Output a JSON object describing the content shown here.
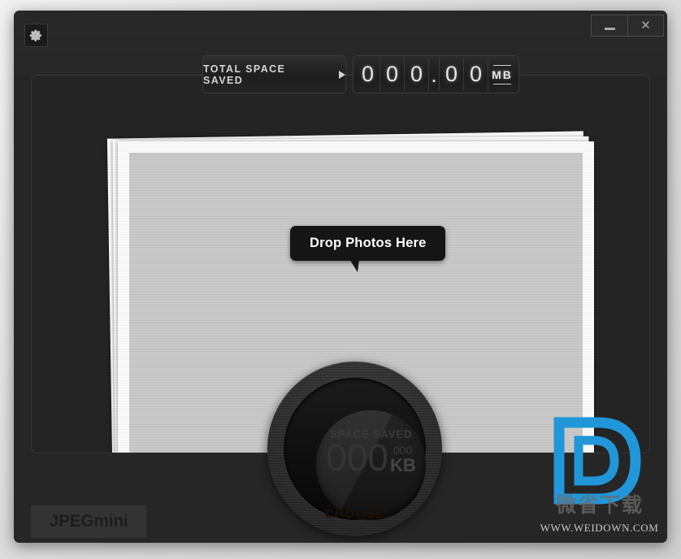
{
  "window": {
    "controls": {
      "minimize_label": "–",
      "close_label": "✕"
    },
    "settings_icon": "gear-icon"
  },
  "counter": {
    "button_label": "TOTAL SPACE SAVED",
    "arrow_icon": "play-triangle-icon",
    "digits": [
      "0",
      "0",
      "0",
      ".",
      "0",
      "0"
    ],
    "unit": "MB"
  },
  "drop_area": {
    "tooltip": "Drop Photos Here"
  },
  "dial": {
    "title": "SPACE SAVED",
    "value": "000",
    "decimal": ".000",
    "unit": "KB",
    "choose_label": "CHOOSE",
    "accent_color": "#f0800f"
  },
  "footer": {
    "logo": "JPEGmini"
  },
  "watermark": {
    "letter": "D",
    "chinese": "微省下载",
    "url": "WWW.WEIDOWN.COM",
    "brand_color": "#2196d8"
  }
}
